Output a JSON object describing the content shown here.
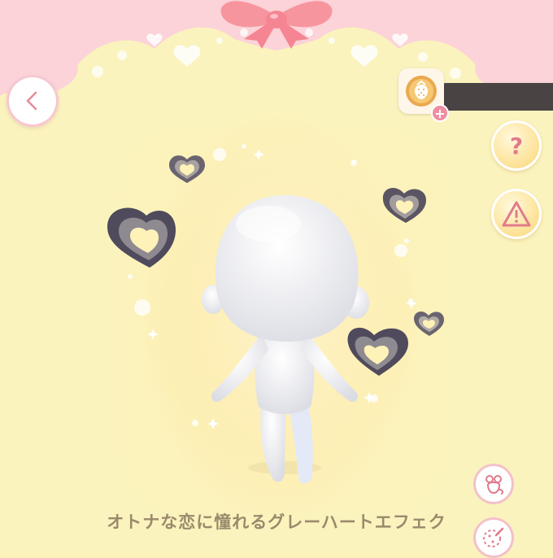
{
  "header": {
    "back_icon": "chevron-left-icon",
    "currency": {
      "icon": "strawberry-coin-icon",
      "amount": ""
    }
  },
  "side_buttons": [
    {
      "id": "help",
      "icon": "question-icon"
    },
    {
      "id": "report",
      "icon": "warning-icon"
    }
  ],
  "bottom_buttons": [
    {
      "id": "pose",
      "icon": "rat-doll-icon"
    },
    {
      "id": "dye",
      "icon": "palette-dropper-icon"
    }
  ],
  "item": {
    "name": "オトナな恋に憧れるグレーハートエフェク",
    "effect": "gray-heart-effect"
  },
  "colors": {
    "background": "#fbf3b8",
    "canopy_pink": "#fbd3d9",
    "ribbon": "#f7959e",
    "heart_dark": "#4f4a5c",
    "heart_mid": "#8f8a90",
    "heart_light": "#fff2b8",
    "caption": "#9a8a6c",
    "accent_pink": "#ef8ea1"
  }
}
